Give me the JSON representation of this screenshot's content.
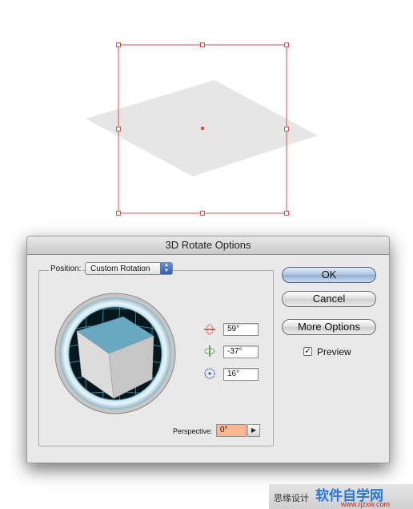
{
  "dialog": {
    "title": "3D Rotate Options",
    "position_label": "Position:",
    "position_value": "Custom Rotation",
    "rotation": {
      "x": "59°",
      "y": "-37°",
      "z": "16°"
    },
    "perspective_label": "Perspective:",
    "perspective_value": "0°",
    "buttons": {
      "ok": "OK",
      "cancel": "Cancel",
      "more_options": "More Options"
    },
    "preview_label": "Preview",
    "preview_checked": true
  },
  "watermark": {
    "small_text": "思缘设计",
    "logo_text": "软件自学网",
    "url_text": "www.rjzxw.com"
  },
  "colors": {
    "selection": "#d9534f",
    "cube_top": "#68a8c0",
    "cube_side": "#d6d6d6",
    "perspective_field": "#fbb890",
    "grid": "#2ba6b8"
  }
}
